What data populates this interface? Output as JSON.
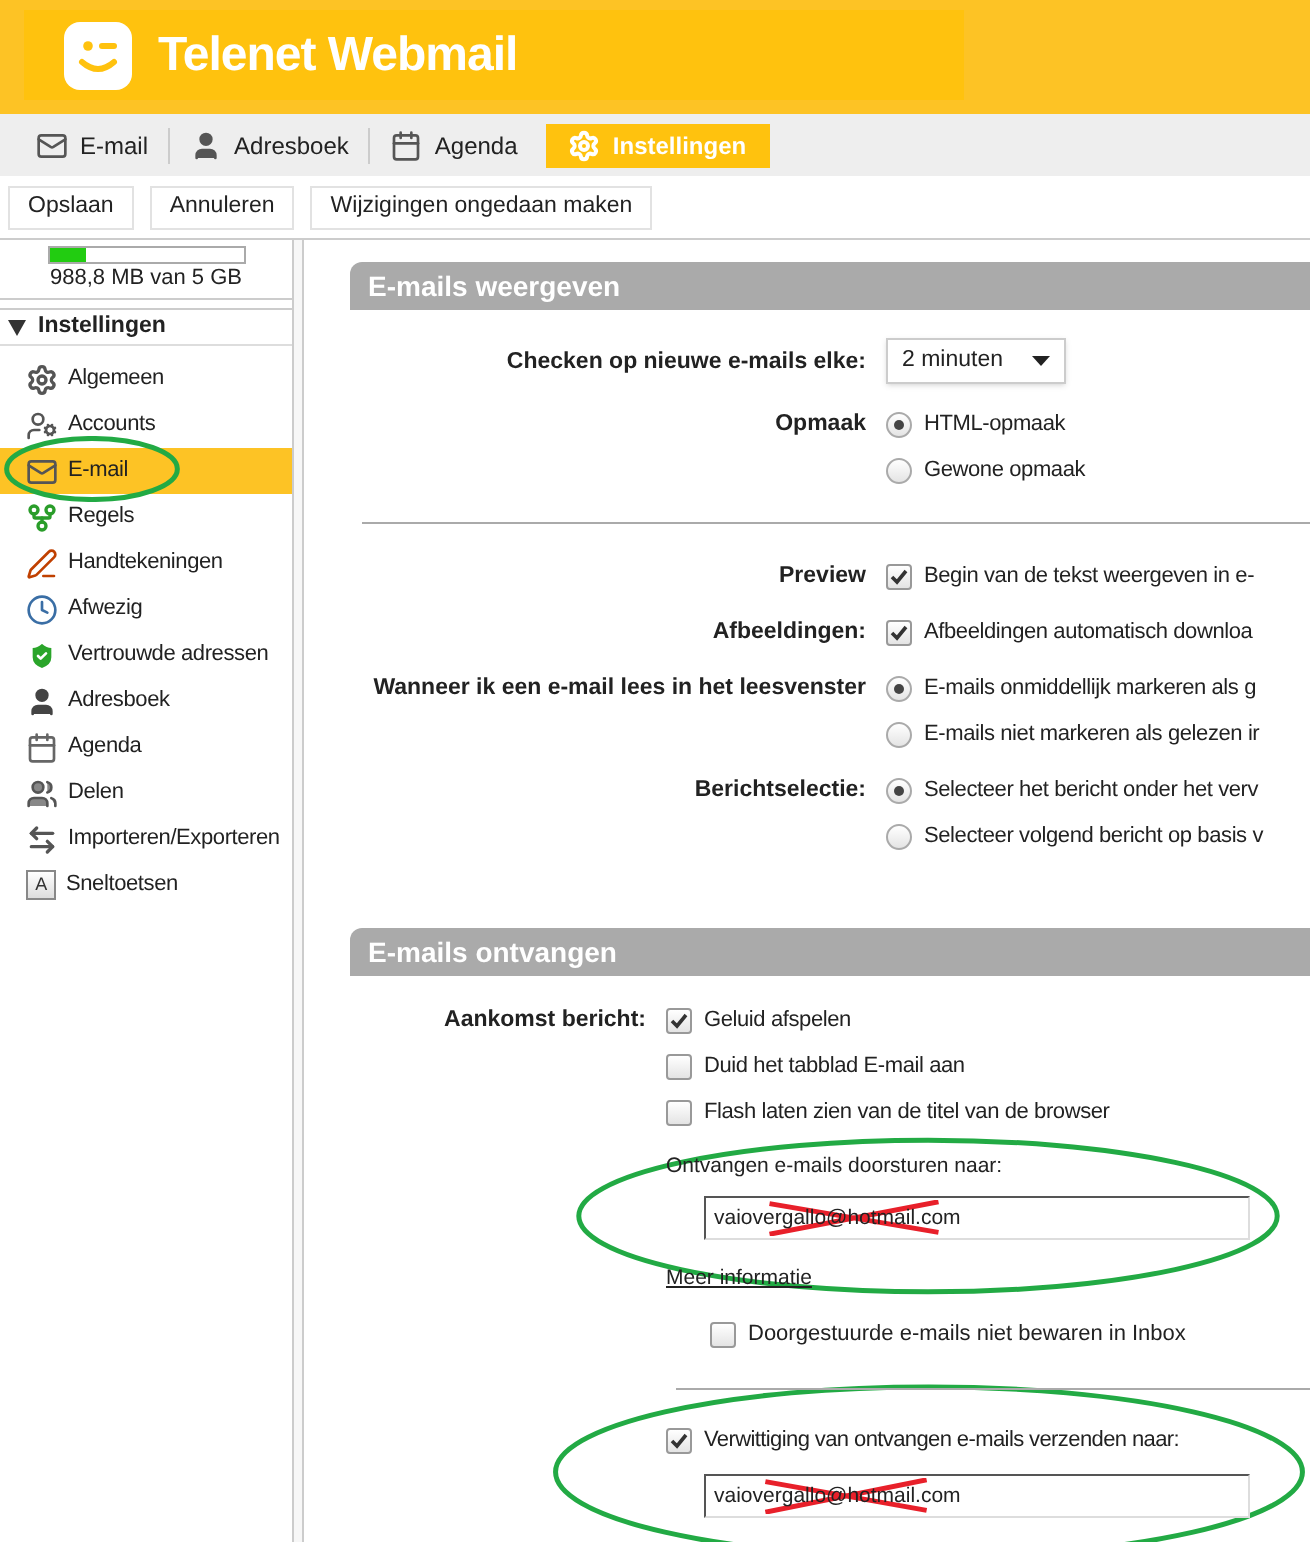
{
  "header": {
    "title": "Telenet Webmail"
  },
  "nav": [
    {
      "label": "E-mail",
      "selected": false
    },
    {
      "label": "Adresboek",
      "selected": false
    },
    {
      "label": "Agenda",
      "selected": false
    },
    {
      "label": "Instellingen",
      "selected": true
    }
  ],
  "toolbar": [
    "Opslaan",
    "Annuleren",
    "Wijzigingen ongedaan maken"
  ],
  "storage": {
    "level": 0.19,
    "text": "988,8 MB van 5 GB"
  },
  "sidebar": {
    "title": "Instellingen",
    "expanded": true,
    "items": [
      {
        "label": "Algemeen",
        "selected": false
      },
      {
        "label": "Accounts",
        "selected": false
      },
      {
        "label": "E-mail",
        "selected": true
      },
      {
        "label": "Regels",
        "selected": false
      },
      {
        "label": "Handtekeningen",
        "selected": false
      },
      {
        "label": "Afwezig",
        "selected": false
      },
      {
        "label": "Vertrouwde adressen",
        "selected": false
      },
      {
        "label": "Adresboek",
        "selected": false
      },
      {
        "label": "Agenda",
        "selected": false
      },
      {
        "label": "Delen",
        "selected": false
      },
      {
        "label": "Importeren/Exporteren",
        "selected": false
      },
      {
        "label": "Sneltoetsen",
        "selected": false,
        "key_text": "A"
      }
    ]
  },
  "sections": [
    {
      "title": "E-mails weergeven",
      "groups": [
        {
          "rows": [
            {
              "kind": "select",
              "label": "Checken op nieuwe e-mails elke:",
              "value": "2 minuten"
            },
            {
              "kind": "radio",
              "label": "Opmaak",
              "options": [
                {
                  "text": "HTML-opmaak",
                  "selected": true
                },
                {
                  "text": "Gewone opmaak",
                  "selected": false
                }
              ]
            }
          ]
        },
        {
          "rows": [
            {
              "kind": "checkbox",
              "label": "Preview",
              "options": [
                {
                  "text": "Begin van de tekst weergeven in e-",
                  "checked": true
                }
              ]
            },
            {
              "kind": "checkbox",
              "label": "Afbeeldingen:",
              "options": [
                {
                  "text": "Afbeeldingen automatisch downloa",
                  "checked": true
                }
              ]
            },
            {
              "kind": "radio",
              "label": "Wanneer ik een e-mail lees in het leesvenster",
              "options": [
                {
                  "text": "E-mails onmiddellijk markeren als g",
                  "selected": true
                },
                {
                  "text": "E-mails niet markeren als gelezen ir",
                  "selected": false
                }
              ]
            },
            {
              "kind": "radio",
              "label": "Berichtselectie:",
              "options": [
                {
                  "text": "Selecteer het bericht onder het verv",
                  "selected": true
                },
                {
                  "text": "Selecteer volgend bericht op basis v",
                  "selected": false
                }
              ]
            }
          ]
        }
      ]
    },
    {
      "title": "E-mails ontvangen",
      "groups": [
        {
          "rows": [
            {
              "kind": "checkbox",
              "label": "Aankomst bericht:",
              "options": [
                {
                  "text": "Geluid afspelen",
                  "checked": true
                },
                {
                  "text": "Duid het tabblad E-mail aan",
                  "checked": false
                },
                {
                  "text": "Flash laten zien van de titel van de browser",
                  "checked": false
                }
              ]
            },
            {
              "kind": "field",
              "label": "Ontvangen e-mails doorsturen naar:",
              "value": "vaiovergallo@hotmail.com"
            },
            {
              "kind": "link",
              "text": "Meer informatie"
            },
            {
              "kind": "subcheckbox",
              "text": "Doorgestuurde e-mails niet bewaren in Inbox",
              "checked": false
            }
          ]
        },
        {
          "rows": [
            {
              "kind": "checkfield",
              "text": "Verwittiging van ontvangen e-mails verzenden naar:",
              "checked": true,
              "value": "vaiovergallo@hotmail.com"
            }
          ]
        }
      ]
    }
  ]
}
